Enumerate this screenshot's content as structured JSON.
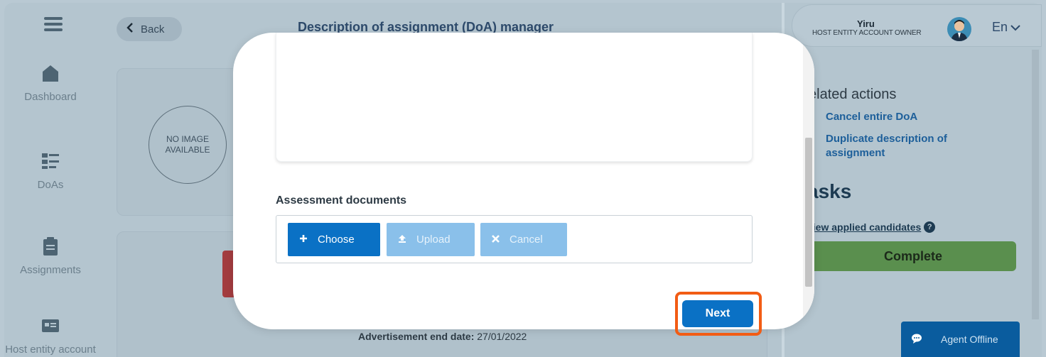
{
  "sidebar": {
    "items": [
      {
        "label": "Dashboard",
        "icon": "home-icon"
      },
      {
        "label": "DoAs",
        "icon": "list-icon"
      },
      {
        "label": "Assignments",
        "icon": "clipboard-icon"
      },
      {
        "label": "Host entity account",
        "icon": "id-card-icon"
      }
    ]
  },
  "header": {
    "back_label": "Back",
    "title": "Description of assignment (DoA) manager"
  },
  "page": {
    "no_image": "NO IMAGE AVAILABLE",
    "adv_end_label": "Advertisement end date:",
    "adv_end_value": "27/01/2022"
  },
  "user": {
    "name": "Yiru",
    "role": "HOST ENTITY ACCOUNT OWNER",
    "language": "En"
  },
  "right_panel": {
    "related_title": "elated actions",
    "link_cancel": "Cancel entire DoA",
    "link_duplicate": "Duplicate description of assignment",
    "tasks_title": "asks",
    "view_candidates": "view applied candidates",
    "complete_label": "Complete"
  },
  "chat": {
    "status": "Agent Offline"
  },
  "modal": {
    "assessment_label": "Assessment documents",
    "choose_label": "Choose",
    "upload_label": "Upload",
    "cancel_label": "Cancel",
    "next_label": "Next"
  },
  "colors": {
    "primary": "#0a71c5",
    "disabled": "#8ac0ea",
    "complete": "#5a8f4e",
    "highlight": "#f25c14"
  }
}
